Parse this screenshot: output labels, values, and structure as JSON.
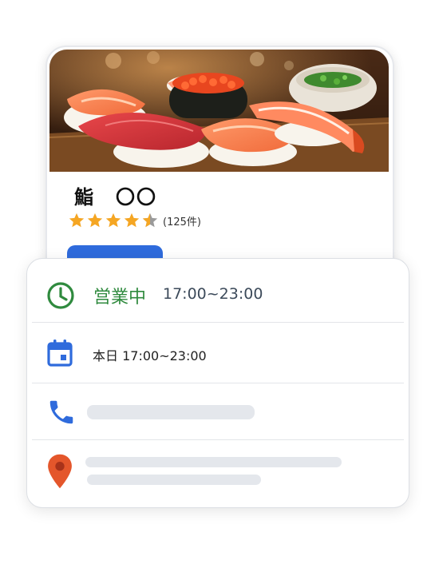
{
  "shop": {
    "name": "鮨　〇〇",
    "rating_value": 4.5,
    "rating_max": 5,
    "review_count_label": "(125件)"
  },
  "info": {
    "status_label": "営業中",
    "hours": "17:00~23:00",
    "today_hours": "本日 17:00~23:00"
  },
  "icons": {
    "status": "clock-icon",
    "today": "calendar-icon",
    "phone": "phone-icon",
    "address": "map-pin-icon"
  },
  "colors": {
    "open_green": "#2f8a3e",
    "accent_blue": "#2f6bdc",
    "star_gold": "#f5a623",
    "pin_orange": "#e4562b"
  }
}
